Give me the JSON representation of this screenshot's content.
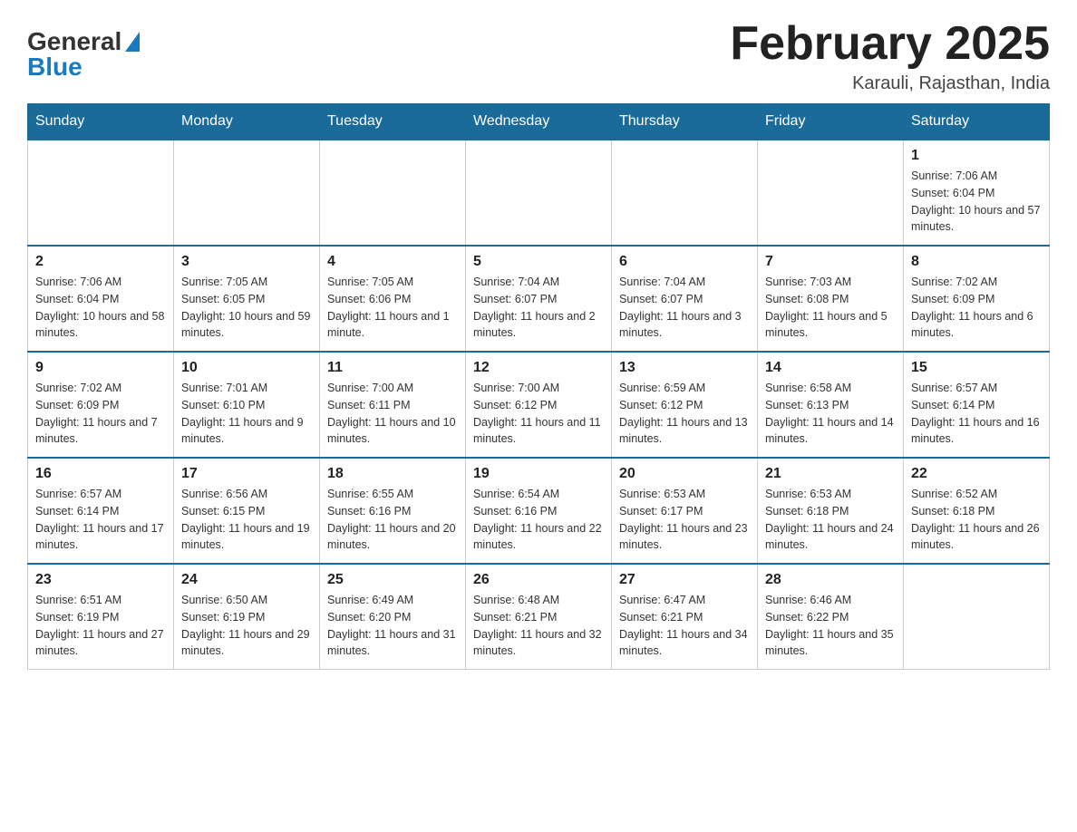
{
  "logo": {
    "general": "General",
    "blue": "Blue"
  },
  "header": {
    "title": "February 2025",
    "location": "Karauli, Rajasthan, India"
  },
  "days_of_week": [
    "Sunday",
    "Monday",
    "Tuesday",
    "Wednesday",
    "Thursday",
    "Friday",
    "Saturday"
  ],
  "weeks": [
    [
      {
        "day": "",
        "info": ""
      },
      {
        "day": "",
        "info": ""
      },
      {
        "day": "",
        "info": ""
      },
      {
        "day": "",
        "info": ""
      },
      {
        "day": "",
        "info": ""
      },
      {
        "day": "",
        "info": ""
      },
      {
        "day": "1",
        "info": "Sunrise: 7:06 AM\nSunset: 6:04 PM\nDaylight: 10 hours and 57 minutes."
      }
    ],
    [
      {
        "day": "2",
        "info": "Sunrise: 7:06 AM\nSunset: 6:04 PM\nDaylight: 10 hours and 58 minutes."
      },
      {
        "day": "3",
        "info": "Sunrise: 7:05 AM\nSunset: 6:05 PM\nDaylight: 10 hours and 59 minutes."
      },
      {
        "day": "4",
        "info": "Sunrise: 7:05 AM\nSunset: 6:06 PM\nDaylight: 11 hours and 1 minute."
      },
      {
        "day": "5",
        "info": "Sunrise: 7:04 AM\nSunset: 6:07 PM\nDaylight: 11 hours and 2 minutes."
      },
      {
        "day": "6",
        "info": "Sunrise: 7:04 AM\nSunset: 6:07 PM\nDaylight: 11 hours and 3 minutes."
      },
      {
        "day": "7",
        "info": "Sunrise: 7:03 AM\nSunset: 6:08 PM\nDaylight: 11 hours and 5 minutes."
      },
      {
        "day": "8",
        "info": "Sunrise: 7:02 AM\nSunset: 6:09 PM\nDaylight: 11 hours and 6 minutes."
      }
    ],
    [
      {
        "day": "9",
        "info": "Sunrise: 7:02 AM\nSunset: 6:09 PM\nDaylight: 11 hours and 7 minutes."
      },
      {
        "day": "10",
        "info": "Sunrise: 7:01 AM\nSunset: 6:10 PM\nDaylight: 11 hours and 9 minutes."
      },
      {
        "day": "11",
        "info": "Sunrise: 7:00 AM\nSunset: 6:11 PM\nDaylight: 11 hours and 10 minutes."
      },
      {
        "day": "12",
        "info": "Sunrise: 7:00 AM\nSunset: 6:12 PM\nDaylight: 11 hours and 11 minutes."
      },
      {
        "day": "13",
        "info": "Sunrise: 6:59 AM\nSunset: 6:12 PM\nDaylight: 11 hours and 13 minutes."
      },
      {
        "day": "14",
        "info": "Sunrise: 6:58 AM\nSunset: 6:13 PM\nDaylight: 11 hours and 14 minutes."
      },
      {
        "day": "15",
        "info": "Sunrise: 6:57 AM\nSunset: 6:14 PM\nDaylight: 11 hours and 16 minutes."
      }
    ],
    [
      {
        "day": "16",
        "info": "Sunrise: 6:57 AM\nSunset: 6:14 PM\nDaylight: 11 hours and 17 minutes."
      },
      {
        "day": "17",
        "info": "Sunrise: 6:56 AM\nSunset: 6:15 PM\nDaylight: 11 hours and 19 minutes."
      },
      {
        "day": "18",
        "info": "Sunrise: 6:55 AM\nSunset: 6:16 PM\nDaylight: 11 hours and 20 minutes."
      },
      {
        "day": "19",
        "info": "Sunrise: 6:54 AM\nSunset: 6:16 PM\nDaylight: 11 hours and 22 minutes."
      },
      {
        "day": "20",
        "info": "Sunrise: 6:53 AM\nSunset: 6:17 PM\nDaylight: 11 hours and 23 minutes."
      },
      {
        "day": "21",
        "info": "Sunrise: 6:53 AM\nSunset: 6:18 PM\nDaylight: 11 hours and 24 minutes."
      },
      {
        "day": "22",
        "info": "Sunrise: 6:52 AM\nSunset: 6:18 PM\nDaylight: 11 hours and 26 minutes."
      }
    ],
    [
      {
        "day": "23",
        "info": "Sunrise: 6:51 AM\nSunset: 6:19 PM\nDaylight: 11 hours and 27 minutes."
      },
      {
        "day": "24",
        "info": "Sunrise: 6:50 AM\nSunset: 6:19 PM\nDaylight: 11 hours and 29 minutes."
      },
      {
        "day": "25",
        "info": "Sunrise: 6:49 AM\nSunset: 6:20 PM\nDaylight: 11 hours and 31 minutes."
      },
      {
        "day": "26",
        "info": "Sunrise: 6:48 AM\nSunset: 6:21 PM\nDaylight: 11 hours and 32 minutes."
      },
      {
        "day": "27",
        "info": "Sunrise: 6:47 AM\nSunset: 6:21 PM\nDaylight: 11 hours and 34 minutes."
      },
      {
        "day": "28",
        "info": "Sunrise: 6:46 AM\nSunset: 6:22 PM\nDaylight: 11 hours and 35 minutes."
      },
      {
        "day": "",
        "info": ""
      }
    ]
  ]
}
